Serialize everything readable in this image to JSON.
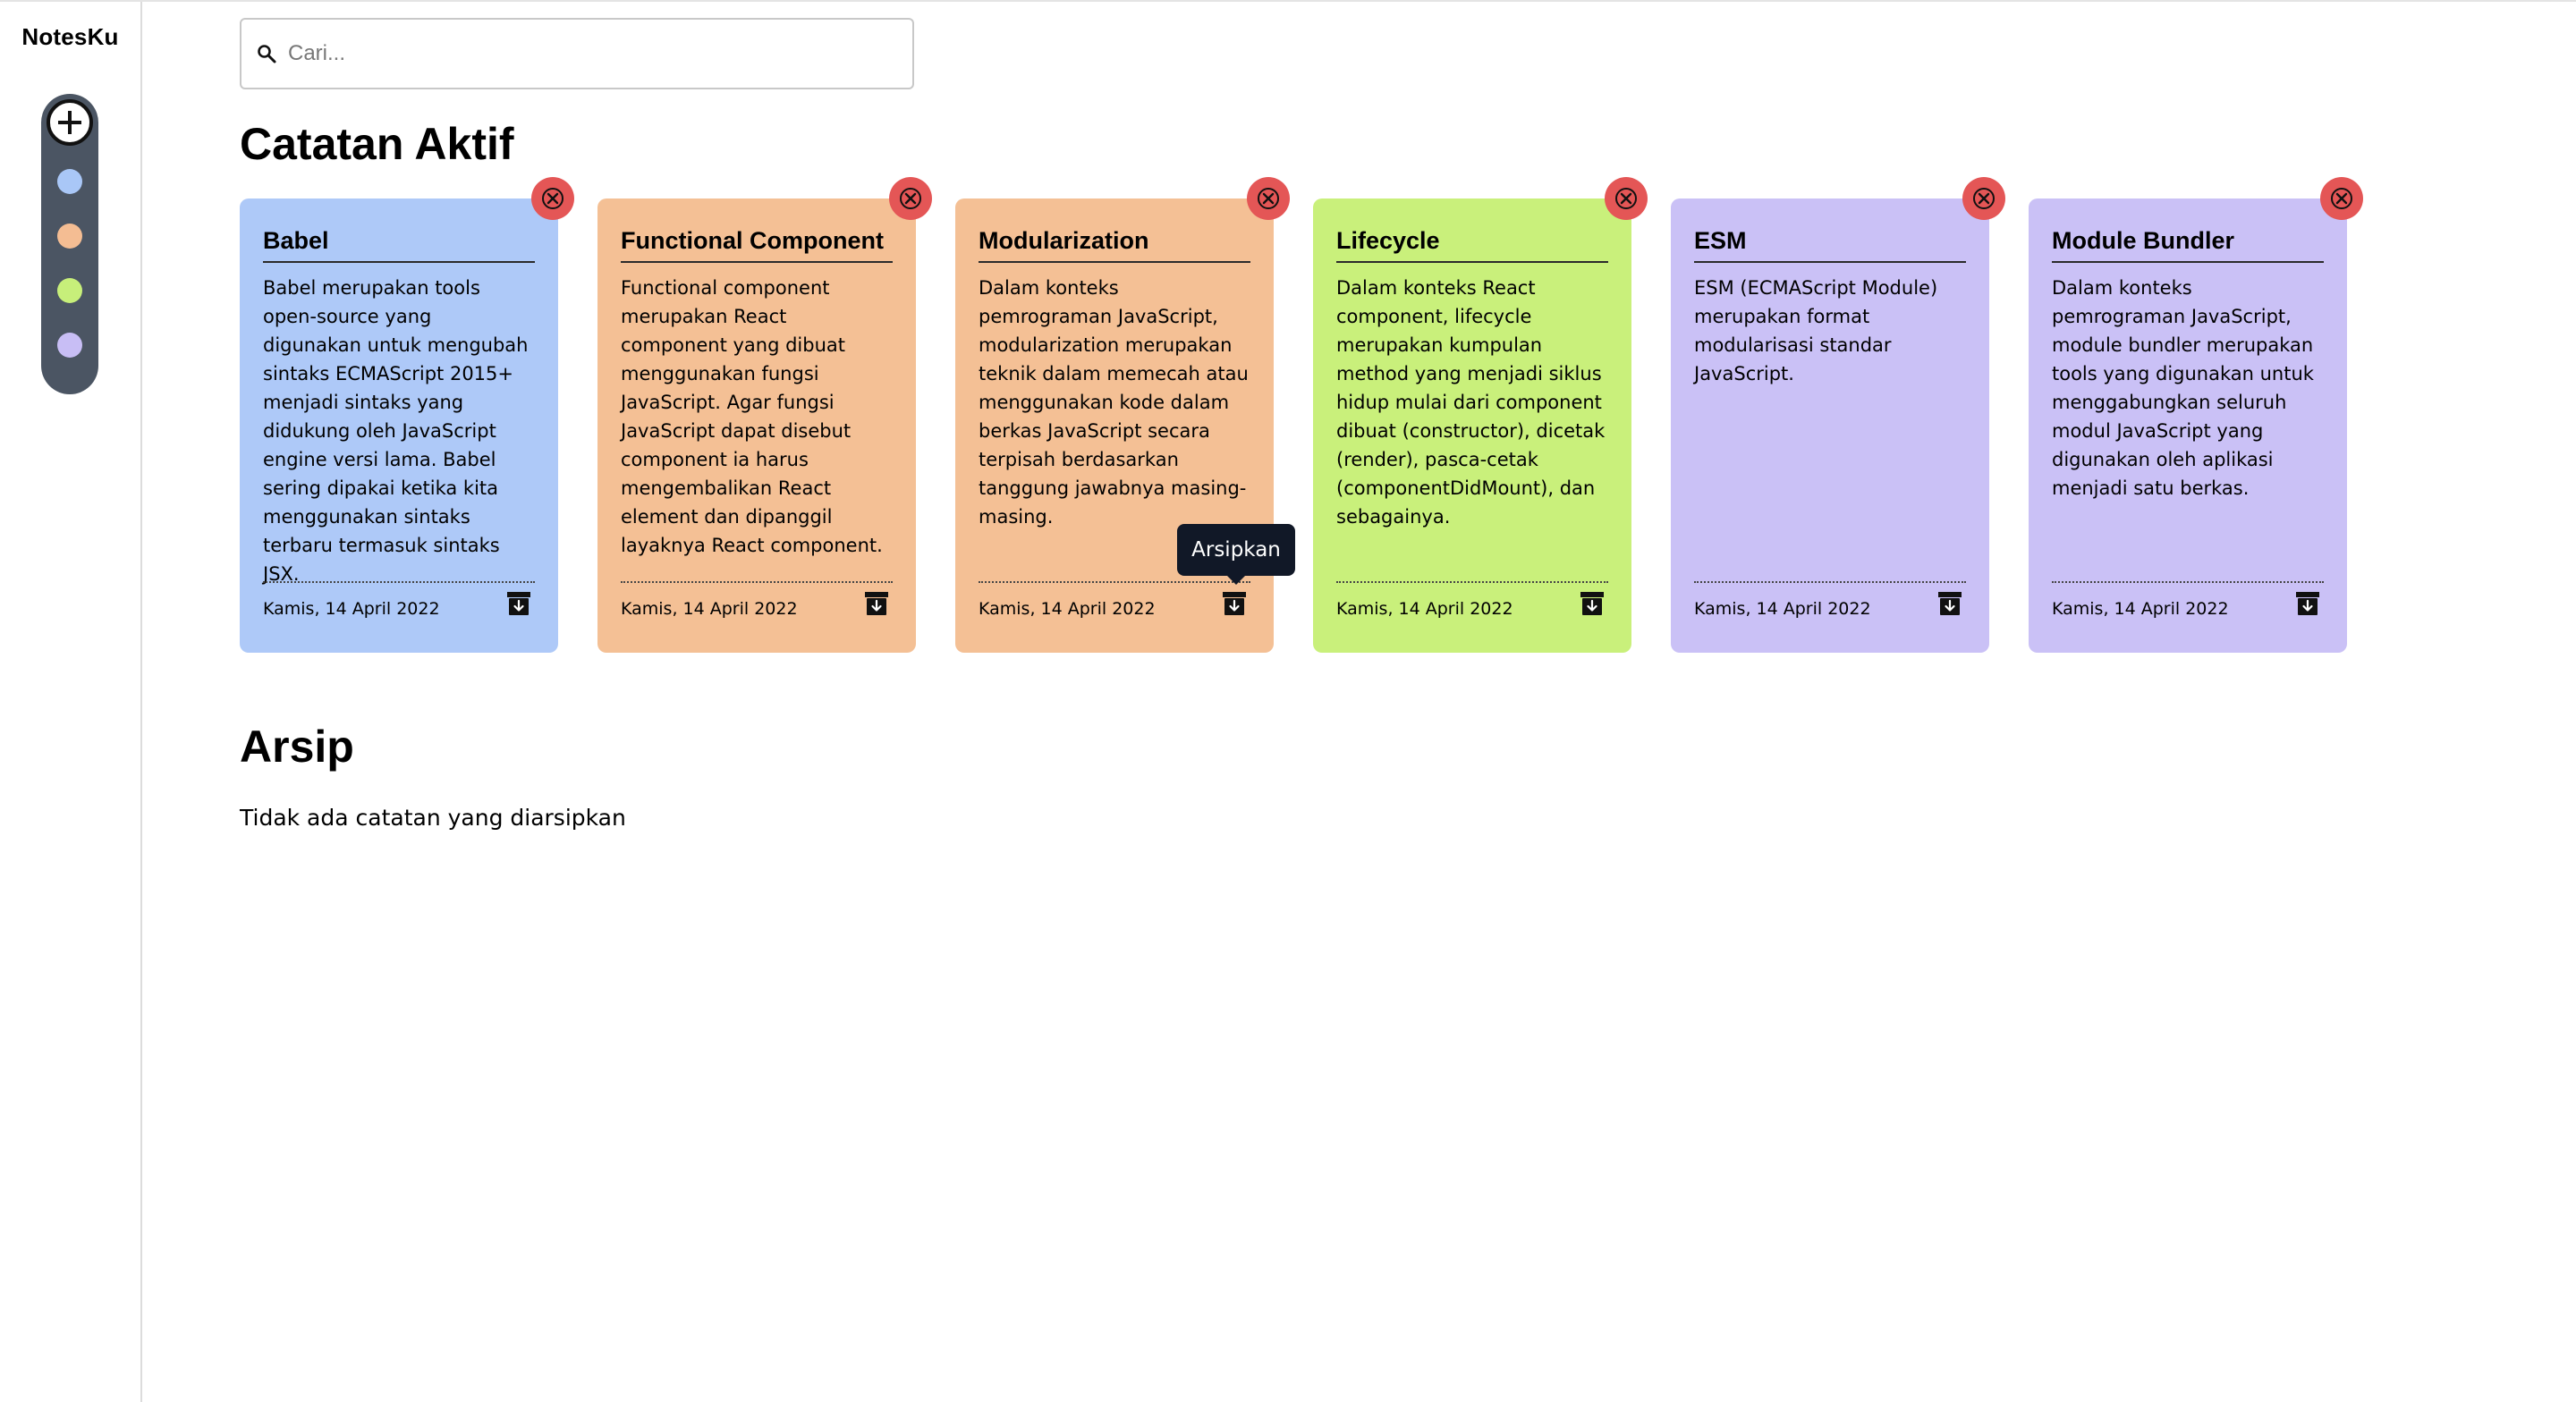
{
  "app": {
    "brand": "NotesKu"
  },
  "sidebar": {
    "colors": [
      "#a9c7f7",
      "#f4bd93",
      "#c7ef7a",
      "#c8bef5"
    ]
  },
  "search": {
    "placeholder": "Cari...",
    "value": ""
  },
  "active": {
    "heading": "Catatan Aktif",
    "notes": [
      {
        "title": "Babel",
        "body": "Babel merupakan tools open-source yang digunakan untuk mengubah sintaks ECMAScript 2015+ menjadi sintaks yang didukung oleh JavaScript engine versi lama. Babel sering dipakai ketika kita menggunakan sintaks terbaru termasuk sintaks JSX.",
        "date": "Kamis, 14 April 2022",
        "color": "#aec9f8"
      },
      {
        "title": "Functional Component",
        "body": "Functional component merupakan React component yang dibuat menggunakan fungsi JavaScript. Agar fungsi JavaScript dapat disebut component ia harus mengembalikan React element dan dipanggil layaknya React component.",
        "date": "Kamis, 14 April 2022",
        "color": "#f4c095"
      },
      {
        "title": "Modularization",
        "body": "Dalam konteks pemrograman JavaScript, modularization merupakan teknik dalam memecah atau menggunakan kode dalam berkas JavaScript secara terpisah berdasarkan tanggung jawabnya masing-masing.",
        "date": "Kamis, 14 April 2022",
        "color": "#f4c095"
      },
      {
        "title": "Lifecycle",
        "body": "Dalam konteks React component, lifecycle merupakan kumpulan method yang menjadi siklus hidup mulai dari component dibuat (constructor), dicetak (render), pasca-cetak (componentDidMount), dan sebagainya.",
        "date": "Kamis, 14 April 2022",
        "color": "#c9f07b"
      },
      {
        "title": "ESM",
        "body": "ESM (ECMAScript Module) merupakan format modularisasi standar JavaScript.",
        "date": "Kamis, 14 April 2022",
        "color": "#cac1f6"
      },
      {
        "title": "Module Bundler",
        "body": "Dalam konteks pemrograman JavaScript, module bundler merupakan tools yang digunakan untuk menggabungkan seluruh modul JavaScript yang digunakan oleh aplikasi menjadi satu berkas.",
        "date": "Kamis, 14 April 2022",
        "color": "#cac1f6"
      }
    ],
    "tooltip": "Arsipkan"
  },
  "archive": {
    "heading": "Arsip",
    "empty_text": "Tidak ada catatan yang diarsipkan"
  },
  "colors": {
    "delete": "#e45656",
    "sidebar_pill": "#4b5563",
    "tooltip": "#111827"
  }
}
